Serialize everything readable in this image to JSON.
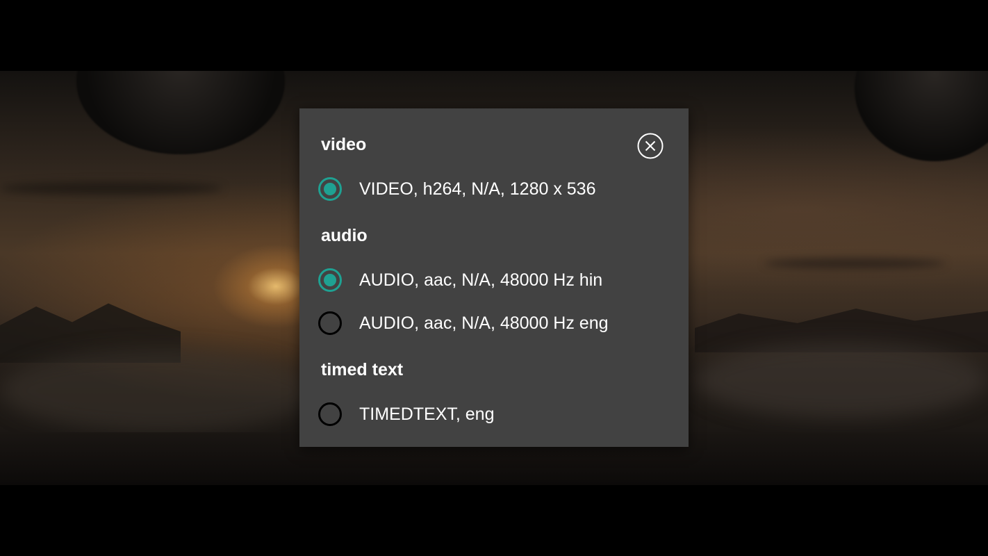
{
  "dialog": {
    "close_icon": "close-circle-icon",
    "sections": [
      {
        "title": "video",
        "options": [
          {
            "label": "VIDEO, h264, N/A, 1280 x 536",
            "selected": true
          }
        ]
      },
      {
        "title": "audio",
        "options": [
          {
            "label": "AUDIO, aac, N/A, 48000 Hz hin",
            "selected": true
          },
          {
            "label": "AUDIO, aac, N/A, 48000 Hz eng",
            "selected": false
          }
        ]
      },
      {
        "title": "timed text",
        "options": [
          {
            "label": "TIMEDTEXT, eng",
            "selected": false
          }
        ]
      }
    ]
  },
  "colors": {
    "panel_background": "#424242",
    "accent": "#1fa192",
    "text": "#ffffff",
    "radio_unchecked": "#000000"
  }
}
